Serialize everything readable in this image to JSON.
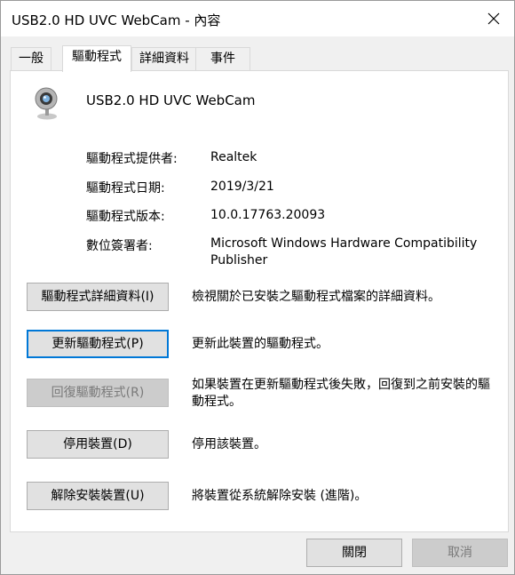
{
  "window": {
    "title": "USB2.0 HD UVC WebCam - 內容",
    "close_icon": "close-icon"
  },
  "tabs": [
    {
      "label": "一般",
      "active": false
    },
    {
      "label": "驅動程式",
      "active": true
    },
    {
      "label": "詳細資料",
      "active": false
    },
    {
      "label": "事件",
      "active": false
    }
  ],
  "device": {
    "name": "USB2.0 HD UVC WebCam",
    "icon": "webcam-icon"
  },
  "driver_info": [
    {
      "label": "驅動程式提供者:",
      "value": "Realtek"
    },
    {
      "label": "驅動程式日期:",
      "value": "2019/3/21"
    },
    {
      "label": "驅動程式版本:",
      "value": "10.0.17763.20093"
    },
    {
      "label": "數位簽署者:",
      "value": "Microsoft Windows Hardware Compatibility Publisher"
    }
  ],
  "actions": [
    {
      "label": "驅動程式詳細資料(I)",
      "description": "檢視關於已安裝之驅動程式檔案的詳細資料。",
      "enabled": true
    },
    {
      "label": "更新驅動程式(P)",
      "description": "更新此裝置的驅動程式。",
      "enabled": true
    },
    {
      "label": "回復驅動程式(R)",
      "description": "如果裝置在更新驅動程式後失敗，回復到之前安裝的驅動程式。",
      "enabled": false
    },
    {
      "label": "停用裝置(D)",
      "description": "停用該裝置。",
      "enabled": true
    },
    {
      "label": "解除安裝裝置(U)",
      "description": "將裝置從系統解除安裝 (進階)。",
      "enabled": true
    }
  ],
  "footer": {
    "close_label": "關閉",
    "cancel_label": "取消"
  }
}
